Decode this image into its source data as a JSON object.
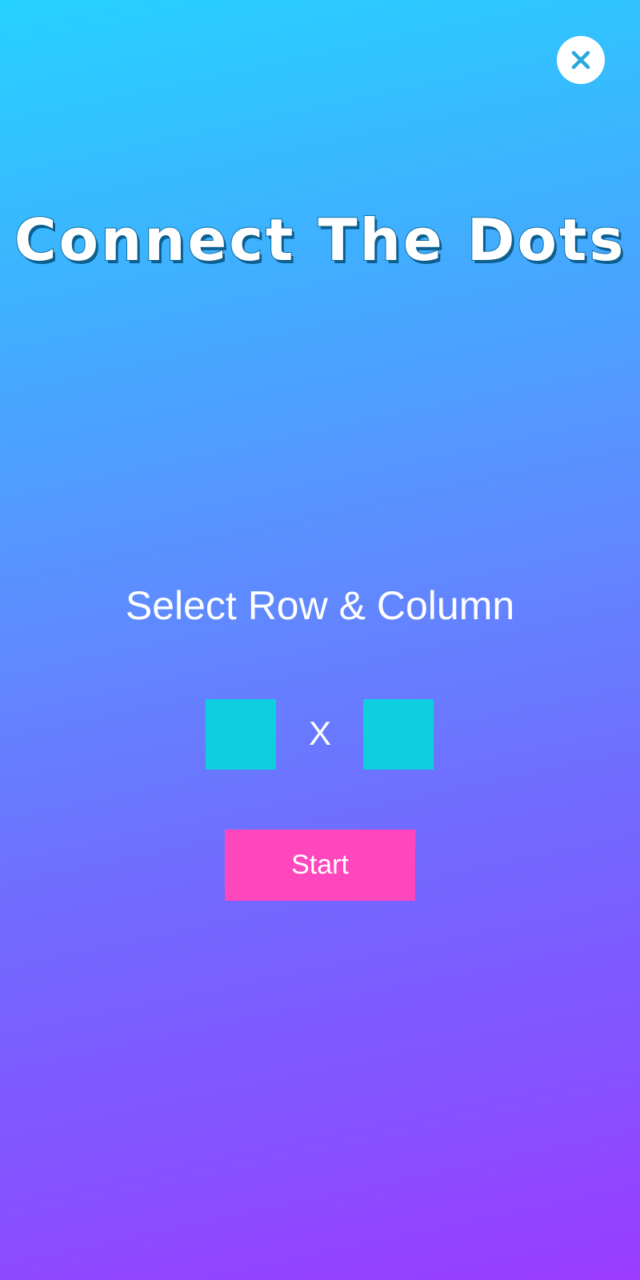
{
  "header": {
    "close_icon": "close-icon"
  },
  "title": "Connect The Dots",
  "selector": {
    "label": "Select Row & Column",
    "row_value": "",
    "column_value": "",
    "separator": "X"
  },
  "actions": {
    "start_label": "Start"
  },
  "colors": {
    "background_top": "#26d2ff",
    "background_bottom": "#9b3bff",
    "input_box": "#0dcfe0",
    "start_button": "#ff47bd",
    "close_icon": "#2aa7dc"
  }
}
